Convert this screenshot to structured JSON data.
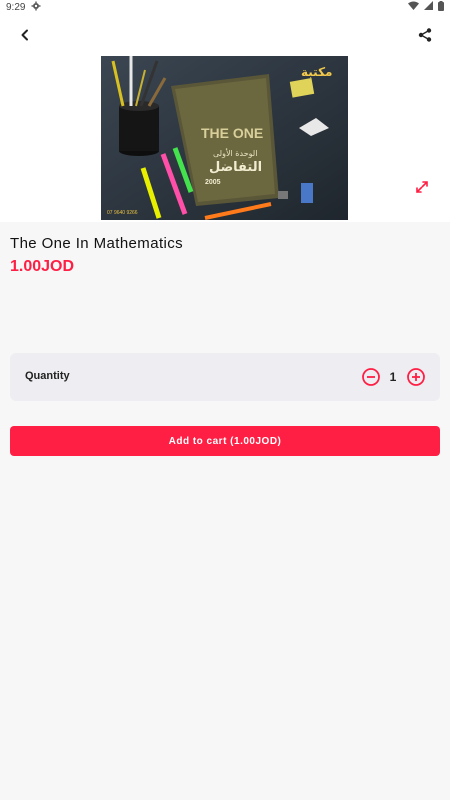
{
  "status_bar": {
    "time": "9:29",
    "icons": [
      "settings-icon",
      "wifi-icon",
      "cell-signal-icon",
      "battery-icon"
    ]
  },
  "app_bar": {
    "icons": [
      "back-arrow-icon",
      "share-icon"
    ]
  },
  "product": {
    "image_text": {
      "brand": "مكتبة",
      "book_title": "THE ONE",
      "unit": "الوحدة الأولى",
      "subject": "التفاضل",
      "edition": "2005",
      "phone": "07 9640 9266"
    },
    "title": "The One In Mathematics",
    "price": "1.00JOD"
  },
  "quantity": {
    "label": "Quantity",
    "value": "1"
  },
  "add_to_cart": {
    "label": "Add to cart (1.00JOD)"
  },
  "colors": {
    "accent": "#ff1f44",
    "background": "#f7f7f8",
    "card": "#eeeef2"
  }
}
